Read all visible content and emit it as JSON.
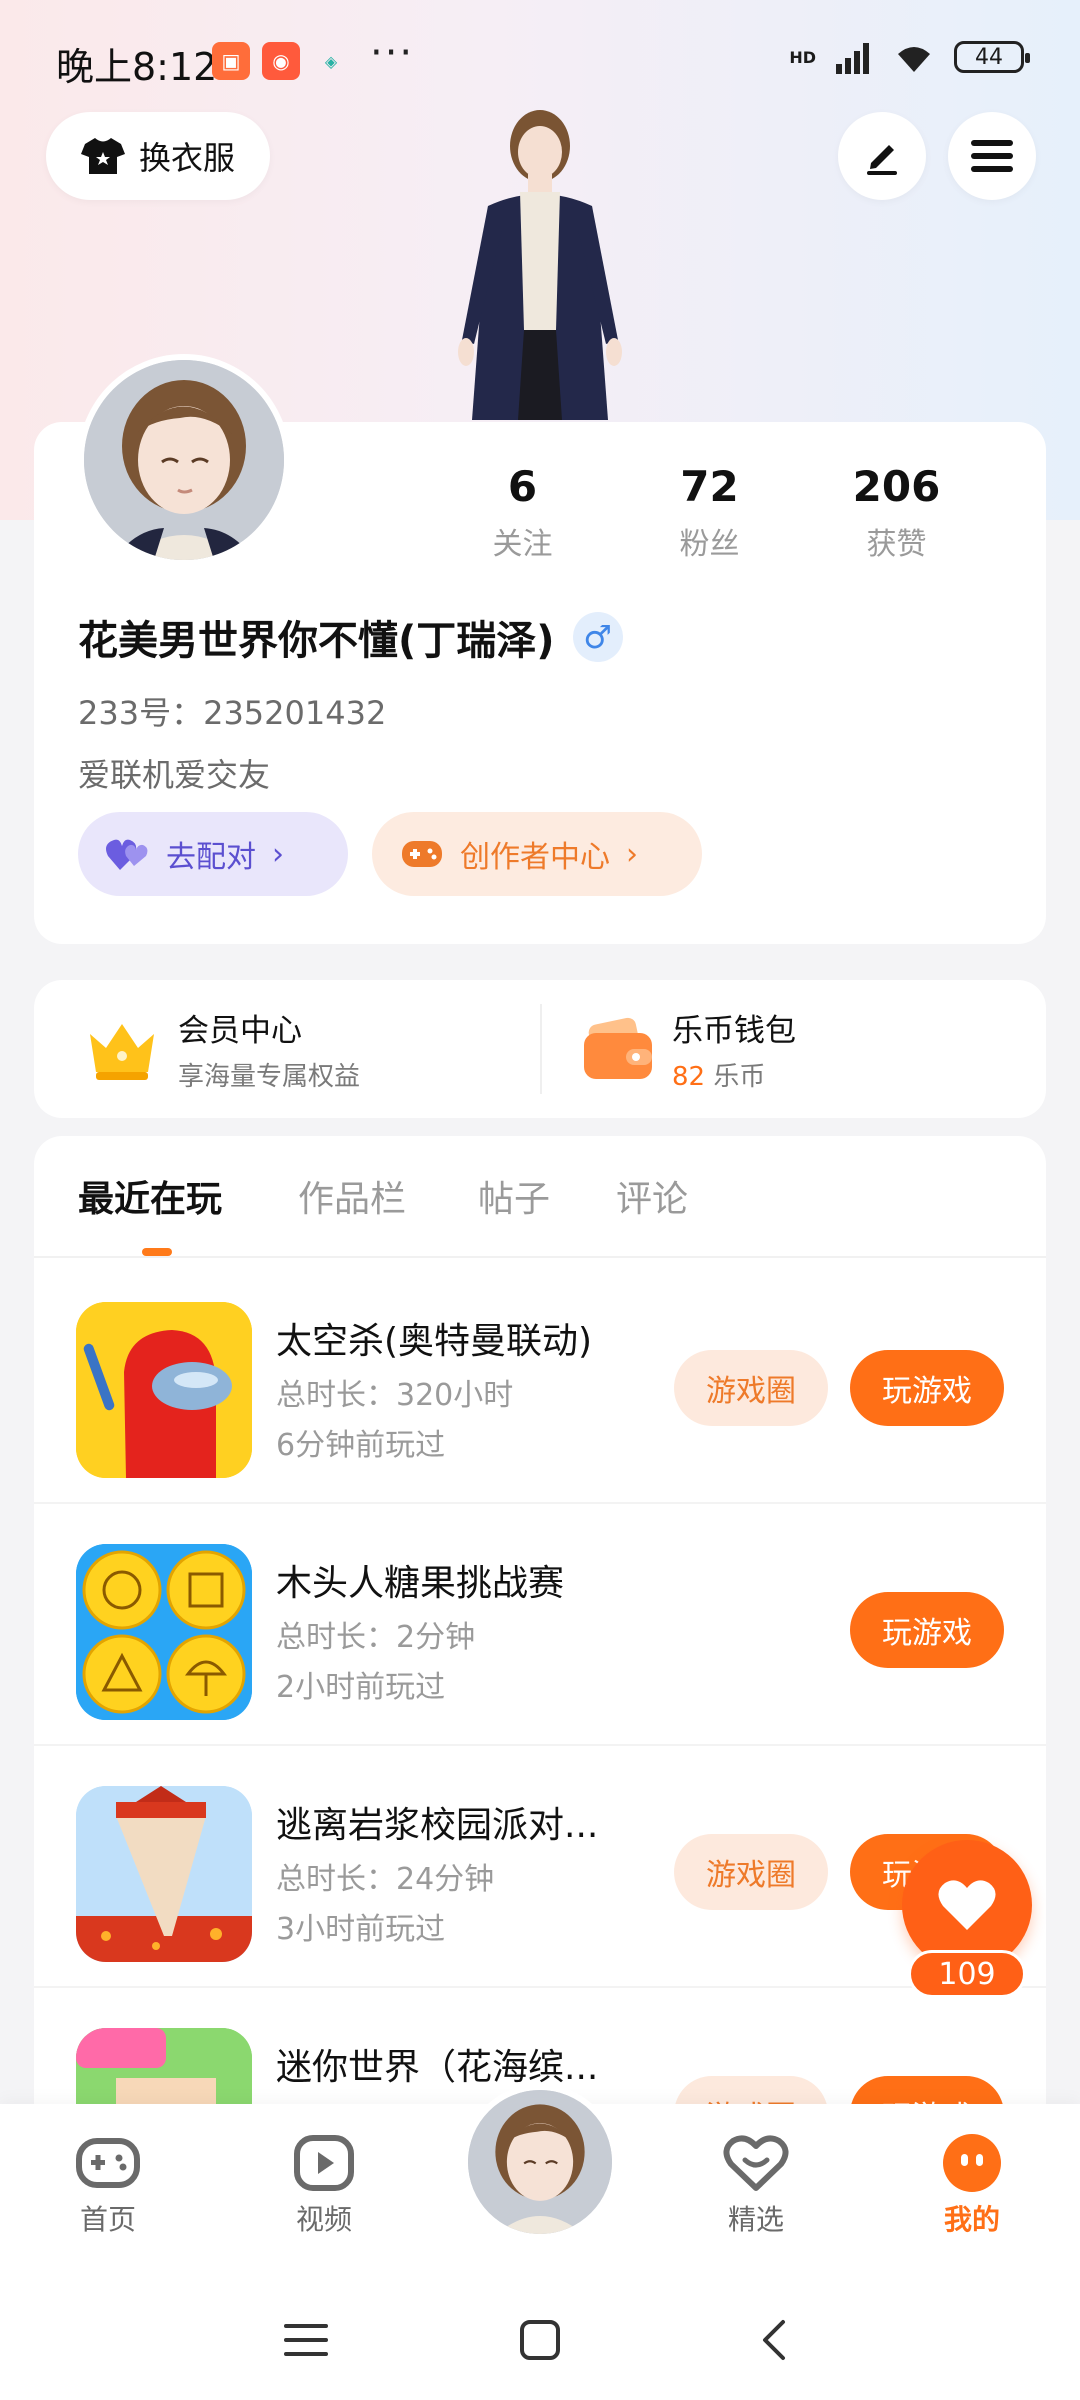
{
  "status_bar": {
    "time": "晚上8:12",
    "battery": "44",
    "network": "HD"
  },
  "header": {
    "outfit_label": "换衣服"
  },
  "profile": {
    "stats": [
      {
        "num": "6",
        "label": "关注"
      },
      {
        "num": "72",
        "label": "粉丝"
      },
      {
        "num": "206",
        "label": "获赞"
      }
    ],
    "nickname": "花美男世界你不懂(丁瑞泽)",
    "gender_symbol": "♂",
    "uid": "233号：235201432",
    "bio": "爱联机爱交友",
    "match_label": "去配对",
    "creator_label": "创作者中心"
  },
  "member": {
    "title": "会员中心",
    "subtitle": "享海量专属权益"
  },
  "wallet": {
    "title": "乐币钱包",
    "amount": "82",
    "unit": "乐币"
  },
  "tabs": [
    "最近在玩",
    "作品栏",
    "帖子",
    "评论"
  ],
  "games": [
    {
      "name": "太空杀(奥特曼联动)",
      "duration": "总时长：320小时",
      "last": "6分钟前玩过",
      "circle": "游戏圈",
      "play": "玩游戏"
    },
    {
      "name": "木头人糖果挑战赛",
      "duration": "总时长：2分钟",
      "last": "2小时前玩过",
      "circle": "",
      "play": "玩游戏"
    },
    {
      "name": "逃离岩浆校园派对...",
      "duration": "总时长：24分钟",
      "last": "3小时前玩过",
      "circle": "游戏圈",
      "play": "玩游戏"
    },
    {
      "name": "迷你世界（花海缤...",
      "duration": "",
      "last": "",
      "circle": "游戏圈",
      "play": "玩游戏"
    }
  ],
  "like": {
    "count": "109"
  },
  "bottom_nav": [
    {
      "label": "首页"
    },
    {
      "label": "视频"
    },
    {
      "label": "精选"
    },
    {
      "label": "我的"
    }
  ],
  "colors": {
    "accent": "#ff6f16",
    "match": "#5b4fd0",
    "gender": "#3f86e8"
  }
}
